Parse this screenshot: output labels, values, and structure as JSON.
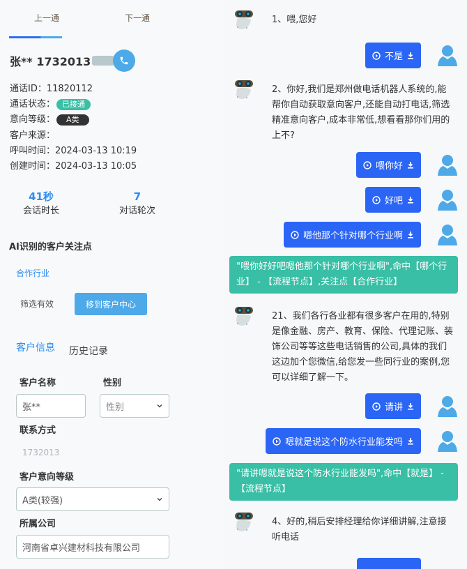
{
  "nav": {
    "prev": "上一通",
    "next": "下一通"
  },
  "customer": {
    "title": "张** 1732013",
    "call_id_label": "通话ID：",
    "call_id": "11820112",
    "status_label": "通话状态：",
    "status": "已接通",
    "level_label": "意向等级：",
    "level": "A类",
    "source_label": "客户来源：",
    "source": "",
    "call_time_label": "呼叫时间：",
    "call_time": "2024-03-13 10:19",
    "create_time_label": "创建时间：",
    "create_time": "2024-03-13 10:05"
  },
  "stats": [
    {
      "value": "41秒",
      "label": "会话时长"
    },
    {
      "value": "7",
      "label": "对话轮次"
    }
  ],
  "ai_focus": {
    "title": "AI识别的客户关注点",
    "tags": [
      "合作行业"
    ],
    "filter_label": "筛选有效",
    "move_button": "移到客户中心"
  },
  "tabs": [
    {
      "label": "客户信息",
      "active": true
    },
    {
      "label": "历史记录",
      "active": false
    }
  ],
  "form": {
    "name_label": "客户名称",
    "name_value": "张**",
    "gender_label": "性别",
    "gender_placeholder": "性别",
    "contact_label": "联系方式",
    "contact_value": "1732013",
    "intent_label": "客户意向等级",
    "intent_value": "A类(较强)",
    "company_label": "所属公司",
    "company_value": "河南省卓兴建材科技有限公司"
  },
  "chat": {
    "colors": {
      "user_bubble": "#2b65f5",
      "hit_box": "#38bfa5",
      "avatar": "#4da9e8"
    },
    "messages": [
      {
        "role": "bot",
        "text": "1、喂,您好"
      },
      {
        "role": "user",
        "text": "不是"
      },
      {
        "role": "bot",
        "text": "2、你好,我们是郑州做电话机器人系统的,能帮你自动获取意向客户,还能自动打电话,筛选精准意向客户,成本非常低,想看看那你们用的上不?"
      },
      {
        "role": "user",
        "text": "喂你好"
      },
      {
        "role": "user",
        "text": "好吧"
      },
      {
        "role": "user",
        "text": "嗯他那个针对哪个行业啊"
      },
      {
        "role": "hit",
        "text": "\"喂你好好吧嗯他那个针对哪个行业啊\",命中【哪个行业】 - 【流程节点】,关注点【合作行业】"
      },
      {
        "role": "bot",
        "text": "21、我们各行各业都有很多客户在用的,特别是像金融、房产、教育、保险、代理记账、装饰公司等等这些电话销售的公司,具体的我们这边加个您微信,给您发一些同行业的案例,您可以详细了解一下。"
      },
      {
        "role": "user",
        "text": "请讲"
      },
      {
        "role": "user",
        "text": "嗯就是说这个防水行业能发吗"
      },
      {
        "role": "hit",
        "text": "\"请讲嗯就是说这个防水行业能发吗\",命中【就是】 - 【流程节点】"
      },
      {
        "role": "bot",
        "text": "4、好的,稍后安排经理给你详细讲解,注意接听电话"
      }
    ]
  }
}
